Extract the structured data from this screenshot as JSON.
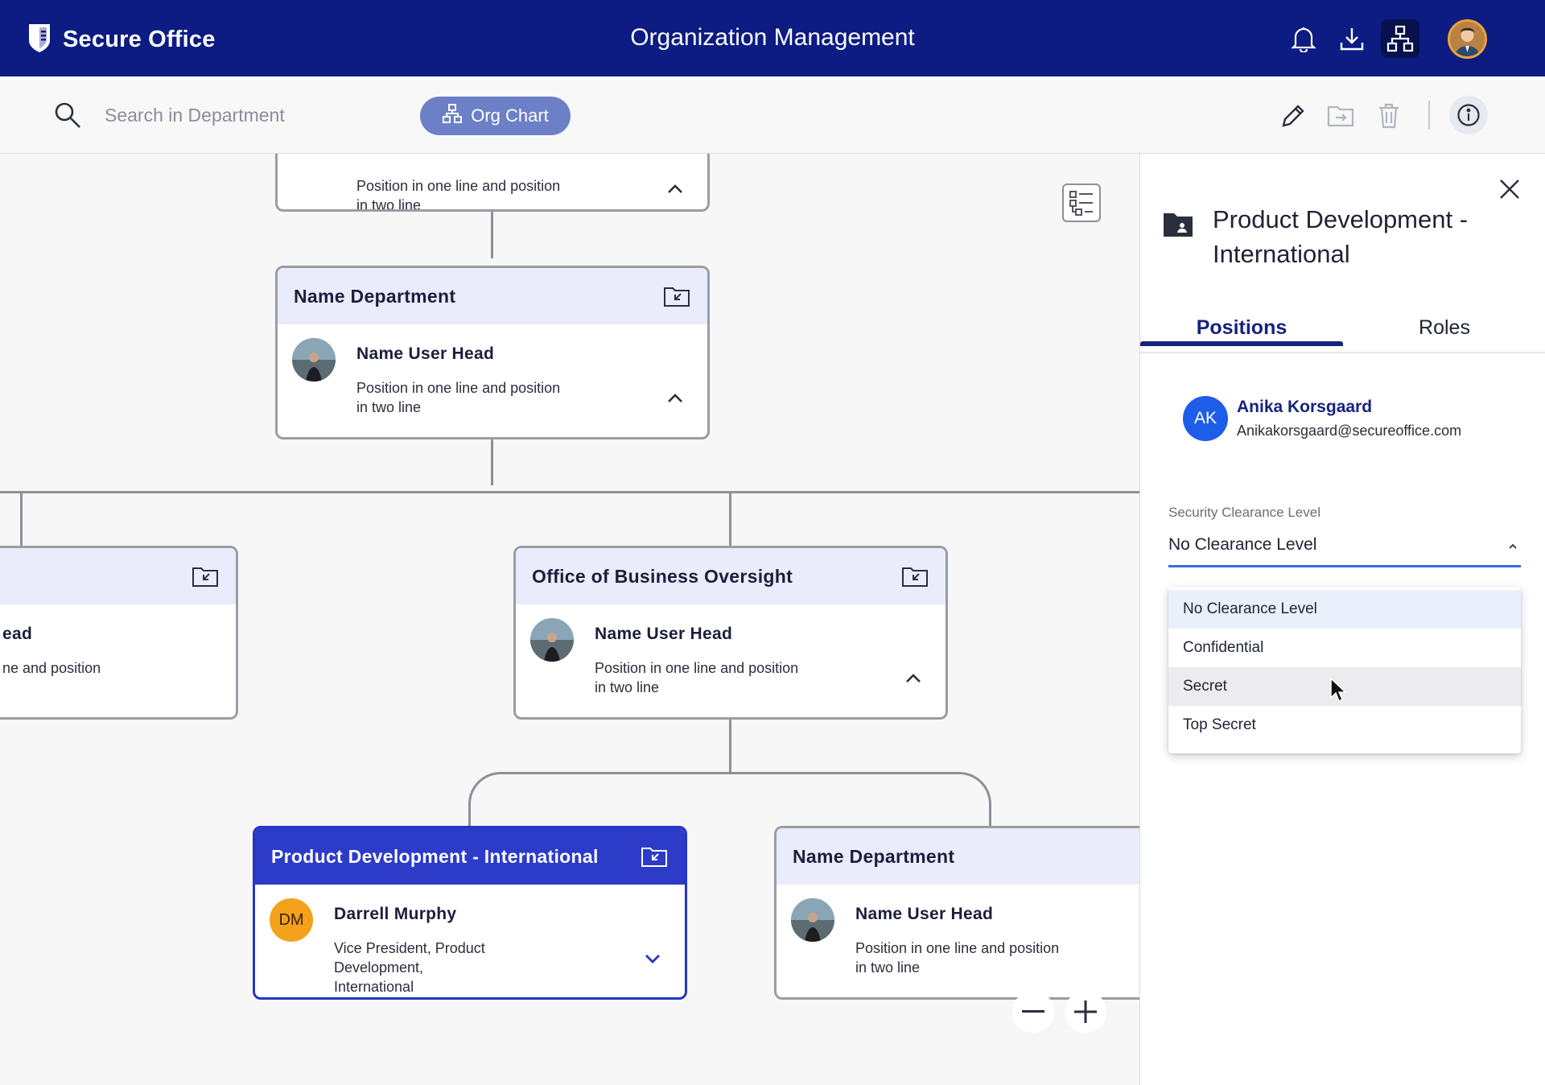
{
  "header": {
    "brand": "Secure Office",
    "title": "Organization Management",
    "icons": [
      "shield-logo-icon",
      "bell-icon",
      "download-icon",
      "org-chart-icon",
      "avatar"
    ]
  },
  "toolbar": {
    "search_placeholder": "Search in Department",
    "org_chart_label": "Org Chart",
    "icons": [
      "edit-icon",
      "move-icon",
      "delete-icon",
      "info-icon"
    ]
  },
  "chart": {
    "cards": [
      {
        "department": "",
        "user": "",
        "position": "Position in one line and position in two line",
        "position_l1": "Position in one line and position",
        "position_l2": "in two line"
      },
      {
        "department": "Name Department",
        "user": "Name User Head",
        "position_l1": "Position in one line and position",
        "position_l2": "in two line"
      },
      {
        "department": "",
        "user": "ead",
        "position_l1": "ne and position",
        "position_l2": ""
      },
      {
        "department": "Office of Business Oversight",
        "user": "Name User Head",
        "position_l1": "Position in one line and position",
        "position_l2": "in two line"
      },
      {
        "department": "Product Development - International",
        "user": "Darrell Murphy",
        "initials": "DM",
        "position_l1": "Vice President, Product Development,",
        "position_l2": "International",
        "selected": true
      },
      {
        "department": "Name Department",
        "user": "Name User Head",
        "position_l1": "Position in one line and position",
        "position_l2": "in two line"
      }
    ],
    "zoom_out_icon": "minus-icon",
    "zoom_in_icon": "plus-icon"
  },
  "panel": {
    "title": "Product Development - International",
    "tabs": [
      {
        "label": "Positions",
        "active": true
      },
      {
        "label": "Roles",
        "active": false
      }
    ],
    "member": {
      "initials": "AK",
      "name": "Anika Korsgaard",
      "email": "Anikakorsgaard@secureoffice.com"
    },
    "clearance": {
      "label": "Security Clearance Level",
      "value": "No Clearance Level",
      "options": [
        "No Clearance Level",
        "Confidential",
        "Secret",
        "Top Secret"
      ],
      "highlighted": "Secret"
    }
  },
  "colors": {
    "topbar": "#0c1c82",
    "accent": "#2d3bc9",
    "card_head": "#eaecfc",
    "org_chart_button": "#6c80c7"
  }
}
